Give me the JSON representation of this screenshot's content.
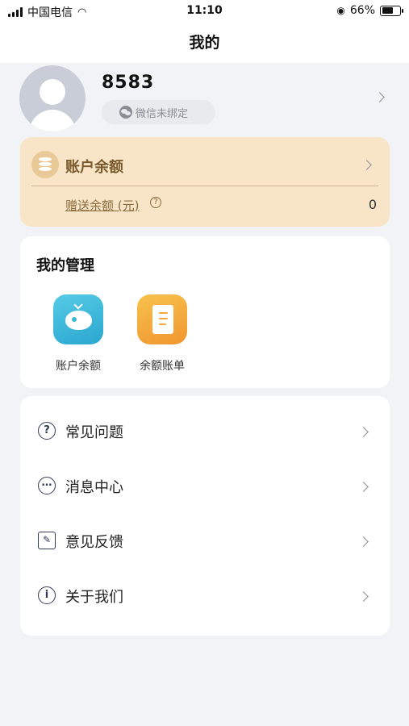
{
  "status_bar": {
    "carrier": "中国电信",
    "time": "11:10",
    "battery": "66%",
    "battery_level": 0.66
  },
  "header": {
    "title": "我的"
  },
  "profile": {
    "username": "8583",
    "wechat_status": "微信未绑定"
  },
  "balance_card": {
    "title": "账户余额",
    "gift_label": "赠送余额 (元)",
    "gift_help": "?",
    "gift_value": "0"
  },
  "management": {
    "title": "我的管理",
    "items": [
      {
        "label": "账户余额",
        "icon": "piggy-bank-icon",
        "color": "#3fb6d9"
      },
      {
        "label": "余额账单",
        "icon": "bill-scroll-icon",
        "color": "#f4a93b"
      }
    ]
  },
  "menu": {
    "items": [
      {
        "label": "常见问题",
        "icon": "question-icon",
        "glyph": "?"
      },
      {
        "label": "消息中心",
        "icon": "message-icon",
        "glyph": "…"
      },
      {
        "label": "意见反馈",
        "icon": "feedback-icon",
        "glyph": "✎"
      },
      {
        "label": "关于我们",
        "icon": "info-icon",
        "glyph": "i"
      }
    ]
  },
  "colors": {
    "accent_gold_bg": "#f8e5c8",
    "accent_gold_text": "#7a5a2c",
    "page_bg": "#f2f3f7"
  }
}
